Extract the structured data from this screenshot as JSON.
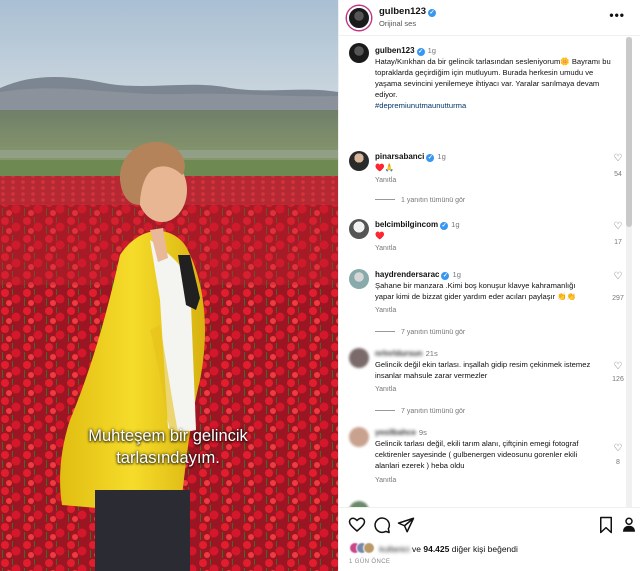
{
  "post": {
    "username": "gulben123",
    "audio": "Orijinal ses",
    "subtitle_line1": "Muhteşem bir gelincik",
    "subtitle_line2": "tarlasındayım.",
    "more_icon": "more-horizontal-icon"
  },
  "caption": {
    "username": "gulben123",
    "time": "1g",
    "text": "Hatay/Kırıkhan da bir gelincik tarlasından sesleniyorum🌼 Bayramı bu topraklarda geçirdiğim için mutluyum. Burada herkesin umudu ve yaşama sevincini yenilemeye ihtiyacı var. Yaralar sarılmaya devam ediyor.",
    "hashtag": "#depremiunutmaunutturma"
  },
  "comments": [
    {
      "username": "pinarsabanci",
      "time": "1g",
      "text": "♥️🙏",
      "reply": "Yanıtla",
      "likes": "54",
      "more": "1 yanıtın tümünü gör"
    },
    {
      "username": "belcimbilgincom",
      "time": "1g",
      "text": "♥️",
      "reply": "Yanıtla",
      "likes": "17",
      "more": ""
    },
    {
      "username": "haydrendersarac",
      "time": "1g",
      "text": "Şahane bir manzara .Kimi boş konuşur klavye kahramanlığı yapar kimi de bizzat gider yardım eder acıları paylaşır 👏👏",
      "reply": "Yanıtla",
      "likes": "297",
      "more": "7 yanıtın tümünü gör"
    },
    {
      "username": "nrlnrldursun",
      "time": "21s",
      "text": "Gelincik değil ekin tarlası. inşallah gidip resim çekinmek istemez insanlar mahsule zarar vermezler",
      "reply": "Yanıtla",
      "likes": "126",
      "more": "7 yanıtın tümünü gör"
    },
    {
      "username": "yesilbahce",
      "time": "9s",
      "text": "Gelincik tarlası değil, ekili tarım alanı, çiftçinin emegi fotograf cektirenler sayesinde ( gulbenergen videosunu gorenler ekili alanlari ezerek ) heba oldu",
      "reply": "Yanıtla",
      "likes": "8",
      "more": ""
    }
  ],
  "footer": {
    "like_icon": "heart-icon",
    "comment_icon": "comment-icon",
    "share_icon": "send-icon",
    "save_icon": "bookmark-icon",
    "likes_prefix": "ve",
    "likes_count": "94.425",
    "likes_suffix": "diğer kişi beğendi",
    "liker_name": "kullanici",
    "when": "1 GÜN ÖNCE"
  },
  "colors": {
    "accent": "#3897f0",
    "hashtag": "#00376b",
    "jacket": "#f2d422",
    "poppy": "#c8102e"
  }
}
